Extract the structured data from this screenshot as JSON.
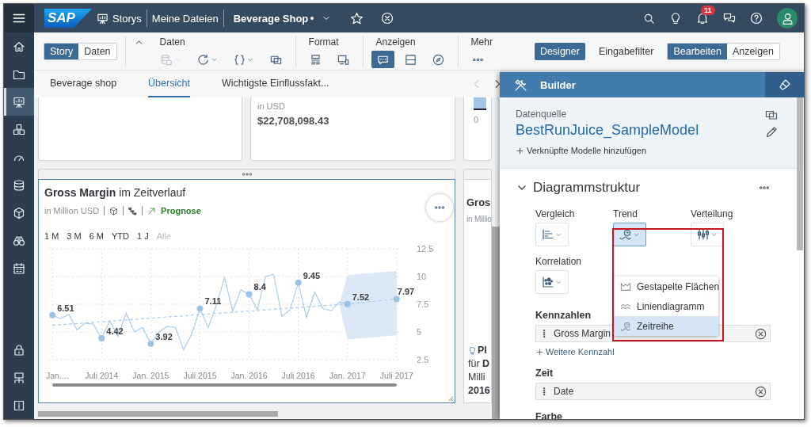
{
  "nav": {
    "items": [
      {
        "kind": "home",
        "selected": false
      },
      {
        "kind": "folder",
        "selected": false
      },
      {
        "kind": "easel",
        "selected": true
      },
      {
        "kind": "cubes",
        "selected": false
      },
      {
        "kind": "gauge",
        "selected": false
      },
      {
        "kind": "stack",
        "selected": false
      },
      {
        "kind": "cube",
        "selected": false
      },
      {
        "kind": "binoculars",
        "selected": false
      },
      {
        "kind": "calendar",
        "selected": false
      }
    ],
    "footer_items": [
      {
        "kind": "lock",
        "selected": false
      },
      {
        "kind": "network",
        "selected": false
      },
      {
        "kind": "info",
        "selected": false
      }
    ]
  },
  "shell": {
    "logo": "SAP",
    "breadcrumbs": [
      "Storys",
      "Meine Dateien"
    ],
    "title": "Beverage Shop",
    "unsaved": true,
    "notification_count": "11"
  },
  "toolbar": {
    "view_toggle": [
      {
        "label": "Story",
        "selected": true
      },
      {
        "label": "Daten",
        "selected": false
      }
    ],
    "groups": [
      {
        "label": "Daten",
        "tools": [
          {
            "kind": "database",
            "dropdown": true,
            "disabled": true,
            "selected": false
          },
          {
            "kind": "refresh",
            "dropdown": true,
            "disabled": false,
            "selected": false
          },
          {
            "kind": "braces",
            "dropdown": true,
            "disabled": false,
            "selected": false
          },
          {
            "kind": "copy",
            "dropdown": false,
            "disabled": false,
            "selected": false
          }
        ]
      },
      {
        "label": "Format",
        "tools": [
          {
            "kind": "layout",
            "dropdown": false,
            "disabled": false,
            "selected": false
          },
          {
            "kind": "device",
            "dropdown": false,
            "disabled": false,
            "selected": false
          }
        ]
      },
      {
        "label": "Anzeigen",
        "tools": [
          {
            "kind": "comment",
            "dropdown": false,
            "disabled": false,
            "selected": true
          },
          {
            "kind": "panel",
            "dropdown": false,
            "disabled": false,
            "selected": false
          },
          {
            "kind": "compass",
            "dropdown": false,
            "disabled": false,
            "selected": false
          }
        ]
      },
      {
        "label": "Mehr",
        "tools": [
          {
            "kind": "more",
            "dropdown": false,
            "disabled": false,
            "selected": false
          }
        ]
      }
    ],
    "modes": [
      {
        "label": "Designer",
        "selected": true
      },
      {
        "label": "Eingabefilter",
        "selected": false
      }
    ],
    "edit_toggle": [
      {
        "label": "Bearbeiten",
        "selected": true
      },
      {
        "label": "Anzeigen",
        "selected": false
      }
    ]
  },
  "page_tabs": {
    "tabs": [
      {
        "label": "Beverage shop",
        "selected": false
      },
      {
        "label": "Übersicht",
        "selected": true
      },
      {
        "label": "Wichtigste Einflussfakt...",
        "selected": false
      }
    ],
    "arrows": [
      {
        "kind": "chevron-left",
        "disabled": true
      },
      {
        "kind": "chevron-right",
        "disabled": false
      }
    ]
  },
  "kpi_card": {
    "unit": "in USD",
    "value": "$22,708,098.43"
  },
  "bar_card": {
    "axis_label": "0"
  },
  "chart_card": {
    "selected": true,
    "title": "**Gross Margin** im Zeitverlauf",
    "unit": "in Million USD",
    "forecast_label": "Prognose",
    "time_filters": [
      {
        "label": "1 M",
        "disabled": false
      },
      {
        "label": "3 M",
        "disabled": false
      },
      {
        "label": "6 M",
        "disabled": false
      },
      {
        "label": "YTD",
        "disabled": false
      },
      {
        "label": "1 J",
        "disabled": false
      },
      {
        "label": "Alle",
        "disabled": true
      }
    ],
    "chart_data": {
      "type": "line",
      "categories": [
        "Jan....",
        null,
        null,
        null,
        null,
        null,
        "Juli 2014",
        null,
        null,
        null,
        null,
        null,
        "Jan. 2015",
        null,
        null,
        null,
        null,
        null,
        "Juli 2015",
        null,
        null,
        null,
        null,
        null,
        "Jan. 2016",
        null,
        null,
        null,
        null,
        null,
        "Juli 2016",
        null,
        null,
        null,
        null,
        null,
        "Jan. 2017",
        null,
        null,
        null,
        null,
        null,
        "Juli 2017"
      ],
      "grid": true,
      "series": [
        {
          "color": "#a9cbeb",
          "line_style": "solid",
          "values": [
            6.51,
            6.2,
            6.6,
            5.2,
            5.8,
            5.7,
            4.42,
            6.0,
            4.6,
            6.7,
            5.0,
            5.4,
            3.92,
            5.0,
            5.5,
            5.4,
            3.4,
            4.8,
            7.11,
            5.4,
            7.4,
            9.9,
            6.9,
            8.8,
            8.4,
            7.0,
            10.0,
            10.2,
            6.4,
            7.0,
            9.45,
            6.3,
            8.6,
            7.1,
            6.9,
            7.7,
            7.52,
            null,
            null,
            null,
            null,
            null,
            null
          ]
        },
        {
          "color": "#a9cbeb",
          "line_style": "dashed",
          "values": [
            5.6,
            5.65,
            5.71,
            5.76,
            5.81,
            5.87,
            5.92,
            5.97,
            6.03,
            6.08,
            6.13,
            6.19,
            6.24,
            6.29,
            6.35,
            6.4,
            6.45,
            6.51,
            6.56,
            6.61,
            6.67,
            6.72,
            6.77,
            6.83,
            6.88,
            6.93,
            6.99,
            7.04,
            7.09,
            7.15,
            7.2,
            7.25,
            7.31,
            7.36,
            7.41,
            7.47,
            7.52,
            7.6,
            7.67,
            7.75,
            7.82,
            7.9,
            7.97
          ]
        }
      ],
      "ylim": [
        2.5,
        12.5
      ],
      "yticks": [
        2.5,
        5,
        7.5,
        10,
        12.5
      ],
      "annotations": [
        {
          "x": "Jan....",
          "y": 6.51,
          "text": "6.51"
        },
        {
          "x": "Juli 2014",
          "y": 4.42,
          "text": "4.42"
        },
        {
          "x": "Jan. 2015",
          "y": 3.92,
          "text": "3.92"
        },
        {
          "x": "Juli 2015",
          "y": 7.11,
          "text": "7.11"
        },
        {
          "x": "Jan. 2016",
          "y": 8.4,
          "text": "8.4"
        },
        {
          "x": "Juli 2016",
          "y": 9.45,
          "text": "9.45"
        },
        {
          "x": "Jan. 2017",
          "y": 7.52,
          "text": "7.52"
        },
        {
          "x": "Juli 2017",
          "y": 7.97,
          "text": "7.97"
        }
      ]
    }
  },
  "side_card": {
    "title": "Gros",
    "unit": "in Millio",
    "insight_lines": [
      {
        "text": "Pl",
        "bold": true
      },
      {
        "text": "für **D**",
        "bold": false
      },
      {
        "text": "Milli",
        "bold": false
      },
      {
        "text": "2016",
        "bold": true
      }
    ]
  },
  "builder": {
    "title": "Builder",
    "source_label": "Datenquelle",
    "model": "BestRunJuice_SampleModel",
    "add_link": "Verknüpfte Modelle hinzufügen",
    "section": {
      "title": "Diagrammstruktur",
      "expanded": true
    },
    "chart_types": [
      {
        "label": "Vergleich",
        "selected": false
      },
      {
        "label": "Trend",
        "selected": true
      },
      {
        "label": "Verteilung",
        "selected": false
      },
      {
        "label": "Korrelation",
        "selected": false
      }
    ],
    "menu": [
      {
        "label": "Gestapelte Flächen",
        "selected": false
      },
      {
        "label": "Liniendiagramm",
        "selected": false
      },
      {
        "label": "Zeitreihe",
        "selected": true
      }
    ],
    "highlight_frame": true,
    "feeds": [
      {
        "label": "Kennzahlen",
        "items": [
          "Gross Margin"
        ],
        "add_label": "Weitere Kennzahl"
      },
      {
        "label": "Zeit",
        "items": [
          "Date"
        ]
      },
      {
        "label": "Farbe"
      }
    ]
  }
}
